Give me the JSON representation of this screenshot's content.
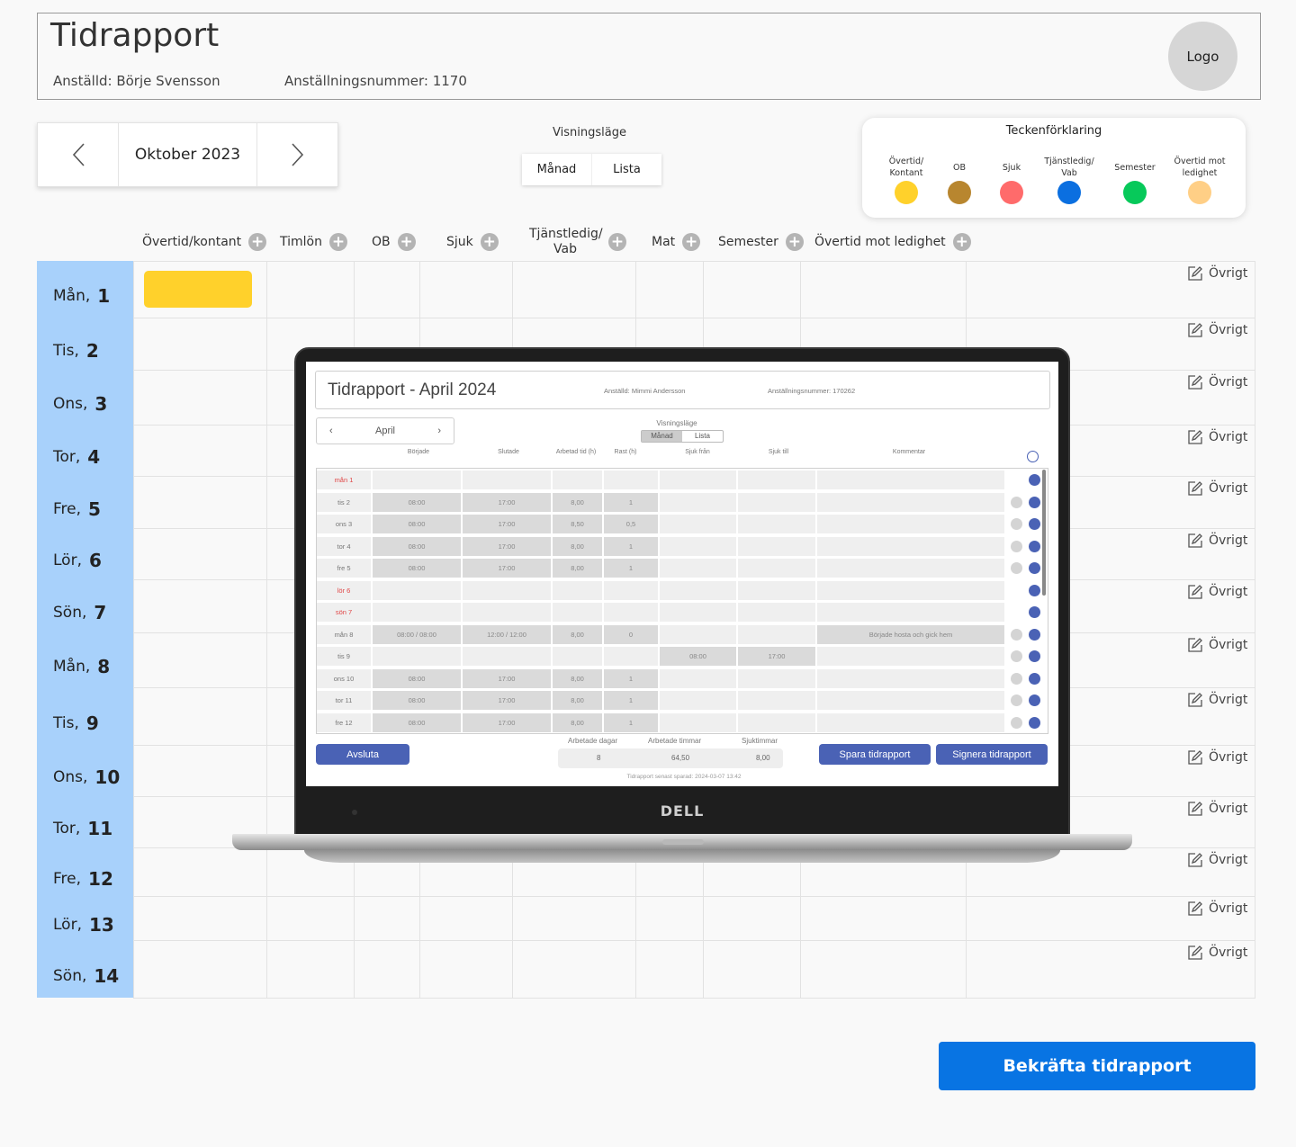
{
  "header": {
    "title": "Tidrapport",
    "employee": "Anställd: Börje Svensson",
    "employee_number": "Anställningsnummer: 1170",
    "logo": "Logo"
  },
  "month_nav": {
    "label": "Oktober 2023",
    "prev_icon": "chevron-left-icon",
    "next_icon": "chevron-right-icon"
  },
  "view_mode": {
    "label": "Visningsläge",
    "options": [
      "Månad",
      "Lista"
    ]
  },
  "legend": {
    "title": "Teckenförklaring",
    "items": [
      {
        "label": "Övertid/ Kontant",
        "color": "#ffd12b"
      },
      {
        "label": "OB",
        "color": "#b8862f"
      },
      {
        "label": "Sjuk",
        "color": "#ff6b6b"
      },
      {
        "label": "Tjänstledig/ Vab",
        "color": "#0b6fe0"
      },
      {
        "label": "Semester",
        "color": "#07c95a"
      },
      {
        "label": "Övertid mot ledighet",
        "color": "#ffcf86"
      }
    ]
  },
  "columns": [
    "Övertid/kontant",
    "Timlön",
    "OB",
    "Sjuk",
    "Tjänstledig/ Vab",
    "Mat",
    "Semester",
    "Övertid mot ledighet"
  ],
  "days": [
    {
      "name": "Mån,",
      "num": "1"
    },
    {
      "name": "Tis,",
      "num": "2"
    },
    {
      "name": "Ons,",
      "num": "3"
    },
    {
      "name": "Tor,",
      "num": "4"
    },
    {
      "name": "Fre,",
      "num": "5"
    },
    {
      "name": "Lör,",
      "num": "6"
    },
    {
      "name": "Sön,",
      "num": "7"
    },
    {
      "name": "Mån,",
      "num": "8"
    },
    {
      "name": "Tis,",
      "num": "9"
    },
    {
      "name": "Ons,",
      "num": "10"
    },
    {
      "name": "Tor,",
      "num": "11"
    },
    {
      "name": "Fre,",
      "num": "12"
    },
    {
      "name": "Lör,",
      "num": "13"
    },
    {
      "name": "Sön,",
      "num": "14"
    }
  ],
  "ovrigt_label": "Övrigt",
  "ovrigt_icon": "edit-icon",
  "highlight_color": "#ffd12b",
  "laptop": {
    "brand": "DELL",
    "title": "Tidrapport - April 2024",
    "employee": "Anställd: Mimmi Andersson",
    "employee_number": "Anställningsnummer: 170262",
    "month": "April",
    "view_label": "Visningsläge",
    "view_options": [
      "Månad",
      "Lista"
    ],
    "headers": [
      "Började",
      "Slutade",
      "Arbetad tid (h)",
      "Rast (h)",
      "Sjuk från",
      "Sjuk till",
      "Kommentar"
    ],
    "rows": [
      {
        "day": "mån 1",
        "red": true,
        "c": [
          "",
          "",
          "",
          "",
          "",
          "",
          ""
        ]
      },
      {
        "day": "tis 2",
        "red": false,
        "c": [
          "08:00",
          "17:00",
          "8,00",
          "1",
          "",
          "",
          ""
        ]
      },
      {
        "day": "ons 3",
        "red": false,
        "c": [
          "08:00",
          "17:00",
          "8,50",
          "0,5",
          "",
          "",
          ""
        ]
      },
      {
        "day": "tor 4",
        "red": false,
        "c": [
          "08:00",
          "17:00",
          "8,00",
          "1",
          "",
          "",
          ""
        ]
      },
      {
        "day": "fre 5",
        "red": false,
        "c": [
          "08:00",
          "17:00",
          "8,00",
          "1",
          "",
          "",
          ""
        ]
      },
      {
        "day": "lör 6",
        "red": true,
        "c": [
          "",
          "",
          "",
          "",
          "",
          "",
          ""
        ]
      },
      {
        "day": "sön 7",
        "red": true,
        "c": [
          "",
          "",
          "",
          "",
          "",
          "",
          ""
        ]
      },
      {
        "day": "mån 8",
        "red": false,
        "c": [
          "08:00 / 08:00",
          "12:00 / 12:00",
          "8,00",
          "0",
          "",
          "",
          "Började hosta och gick hem"
        ]
      },
      {
        "day": "tis 9",
        "red": false,
        "c": [
          "",
          "",
          "",
          "",
          "08:00",
          "17:00",
          ""
        ]
      },
      {
        "day": "ons 10",
        "red": false,
        "c": [
          "08:00",
          "17:00",
          "8,00",
          "1",
          "",
          "",
          ""
        ]
      },
      {
        "day": "tor 11",
        "red": false,
        "c": [
          "08:00",
          "17:00",
          "8,00",
          "1",
          "",
          "",
          ""
        ]
      },
      {
        "day": "fre 12",
        "red": false,
        "c": [
          "08:00",
          "17:00",
          "8,00",
          "1",
          "",
          "",
          ""
        ]
      }
    ],
    "summary_labels": [
      "Arbetade dagar",
      "Arbetade timmar",
      "Sjuktimmar"
    ],
    "summary_values": [
      "8",
      "64,50",
      "8,00"
    ],
    "saved": "Tidrapport senast sparad: 2024-03-07 13:42",
    "btn_exit": "Avsluta",
    "btn_save": "Spara tidrapport",
    "btn_sign": "Signera tidrapport"
  },
  "confirm_button": "Bekräfta tidrapport"
}
